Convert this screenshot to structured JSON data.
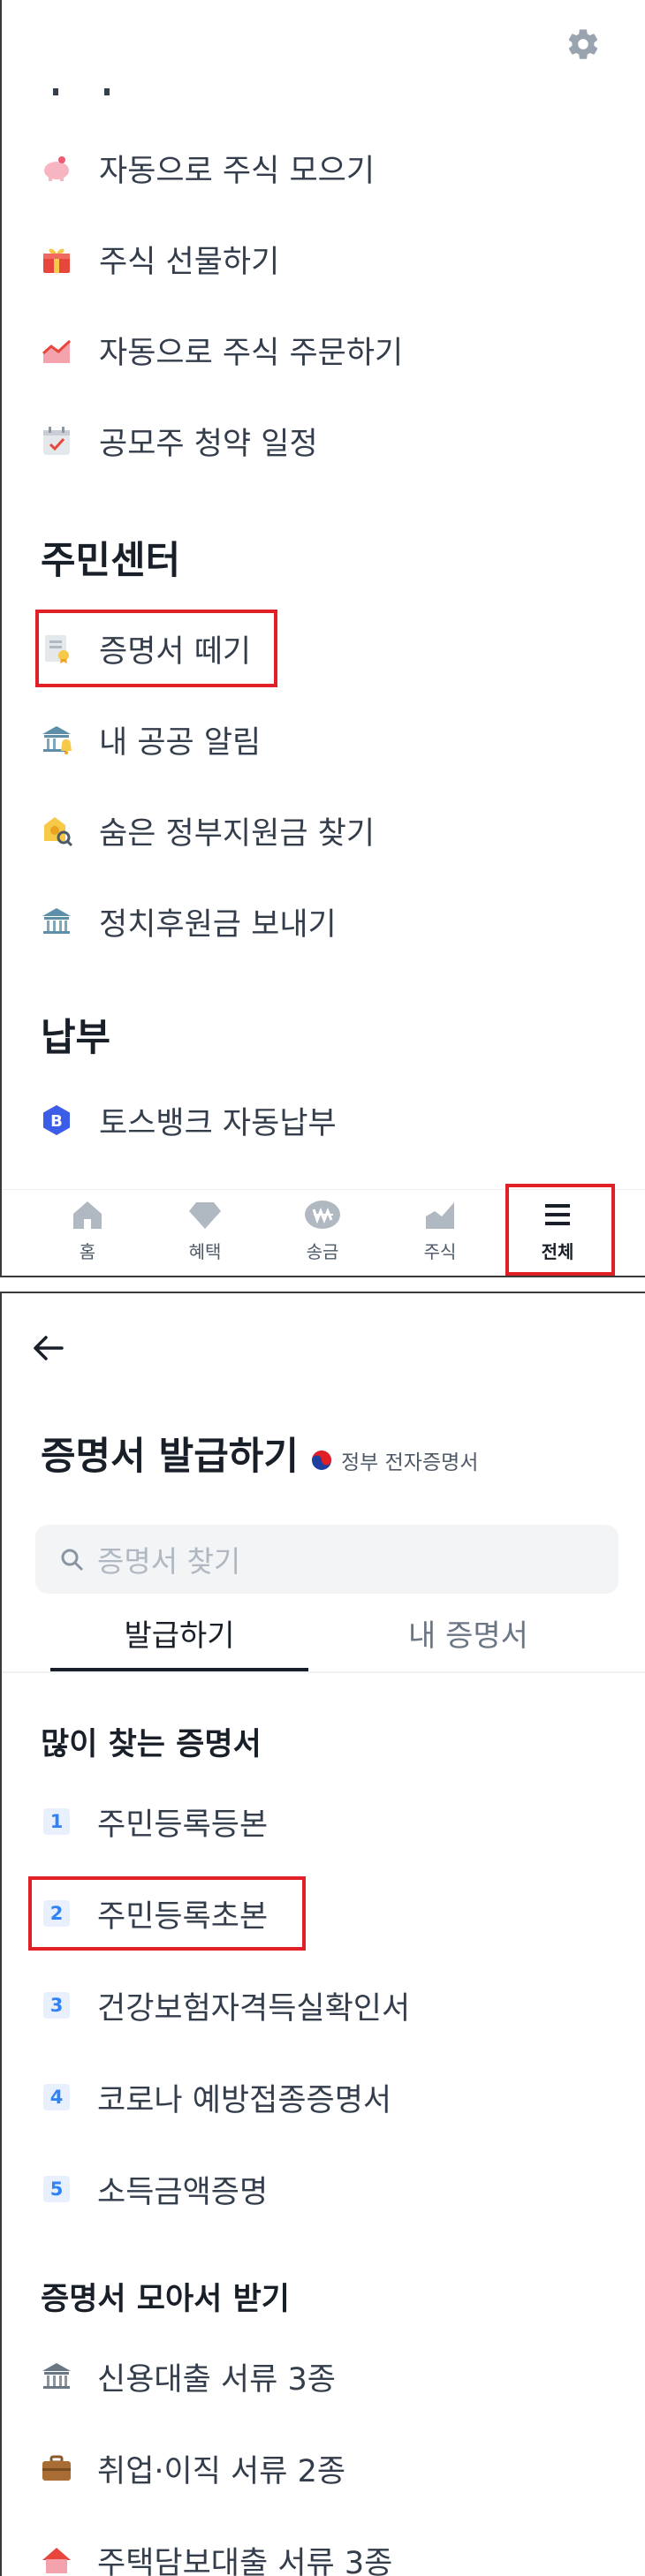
{
  "screen1": {
    "top_menu": [
      {
        "icon": "piggy-bank-icon",
        "label": "자동으로 주식 모으기"
      },
      {
        "icon": "gift-icon",
        "label": "주식 선물하기"
      },
      {
        "icon": "trend-chart-icon",
        "label": "자동으로 주식 주문하기"
      },
      {
        "icon": "calendar-check-icon",
        "label": "공모주 청약 일정"
      }
    ],
    "resident_section": {
      "title": "주민센터",
      "items": [
        {
          "icon": "certificate-icon",
          "label": "증명서 떼기"
        },
        {
          "icon": "bell-building-icon",
          "label": "내 공공 알림"
        },
        {
          "icon": "search-money-icon",
          "label": "숨은 정부지원금 찾기"
        },
        {
          "icon": "government-building-icon",
          "label": "정치후원금 보내기"
        }
      ]
    },
    "payment_section": {
      "title": "납부",
      "items": [
        {
          "icon": "bank-logo-icon",
          "label": "토스뱅크 자동납부",
          "logo_text": "B"
        }
      ]
    },
    "tabs": [
      {
        "icon": "home-icon",
        "label": "홈"
      },
      {
        "icon": "diamond-icon",
        "label": "혜택"
      },
      {
        "icon": "transfer-icon",
        "label": "송금"
      },
      {
        "icon": "stock-icon",
        "label": "주식"
      },
      {
        "icon": "menu-icon",
        "label": "전체"
      }
    ]
  },
  "screen2": {
    "title": "증명서 발급하기",
    "badge": "정부 전자증명서",
    "search_placeholder": "증명서 찾기",
    "tabs": [
      "발급하기",
      "내 증명서"
    ],
    "popular_title": "많이 찾는 증명서",
    "popular": [
      {
        "rank": "1",
        "label": "주민등록등본"
      },
      {
        "rank": "2",
        "label": "주민등록초본"
      },
      {
        "rank": "3",
        "label": "건강보험자격득실확인서"
      },
      {
        "rank": "4",
        "label": "코로나 예방접종증명서"
      },
      {
        "rank": "5",
        "label": "소득금액증명"
      }
    ],
    "bundle_title": "증명서 모아서 받기",
    "bundles": [
      {
        "icon": "bank-building-icon",
        "label": "신용대출 서류 3종"
      },
      {
        "icon": "briefcase-icon",
        "label": "취업·이직 서류 2종"
      },
      {
        "icon": "house-icon",
        "label": "주택담보대출 서류 3종"
      }
    ]
  },
  "colors": {
    "accent": "#3182f6",
    "highlight": "#e01f26",
    "text": "#191f28"
  }
}
